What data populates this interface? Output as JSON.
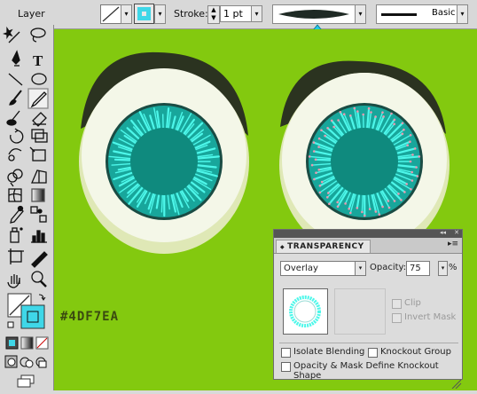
{
  "control_bar": {
    "layer_label": "Layer",
    "stroke_label": "Stroke:",
    "stroke_weight": "1 pt",
    "brush_label": "Basic",
    "dropdown_arrow": "▾",
    "spin_up": "▲",
    "spin_down": "▼"
  },
  "tools": [
    "magic-wand",
    "lasso",
    "pen",
    "type",
    "line-segment",
    "ellipse",
    "paintbrush",
    "pencil",
    "blob-brush",
    "eraser",
    "rotate",
    "scale",
    "warp",
    "free-transform",
    "shape-builder",
    "perspective-grid",
    "mesh",
    "gradient",
    "eyedropper",
    "blend",
    "symbol-sprayer",
    "column-graph",
    "artboard",
    "slice",
    "hand",
    "zoom"
  ],
  "colors": {
    "canvas": "#83c90f",
    "fill": "#3fd7e8",
    "eye_white": "#f4f7e8",
    "iris": "#0f8a7e",
    "iris_strands": "#4df7ea",
    "lid": "#2b3320"
  },
  "canvas": {
    "hex_label": "#4DF7EA"
  },
  "transparency_panel": {
    "title": "TRANSPARENCY",
    "blend_mode": "Overlay",
    "opacity_label": "Opacity:",
    "opacity_value": "75",
    "opacity_unit": "%",
    "clip_label": "Clip",
    "invert_mask_label": "Invert Mask",
    "isolate_blending_label": "Isolate Blending",
    "knockout_group_label": "Knockout Group",
    "define_knockout_label": "Opacity & Mask Define Knockout Shape",
    "menu_glyph": "▸≡",
    "collapse_glyph": "◂◂",
    "close_glyph": "✕",
    "tab_glyph": "◆"
  }
}
